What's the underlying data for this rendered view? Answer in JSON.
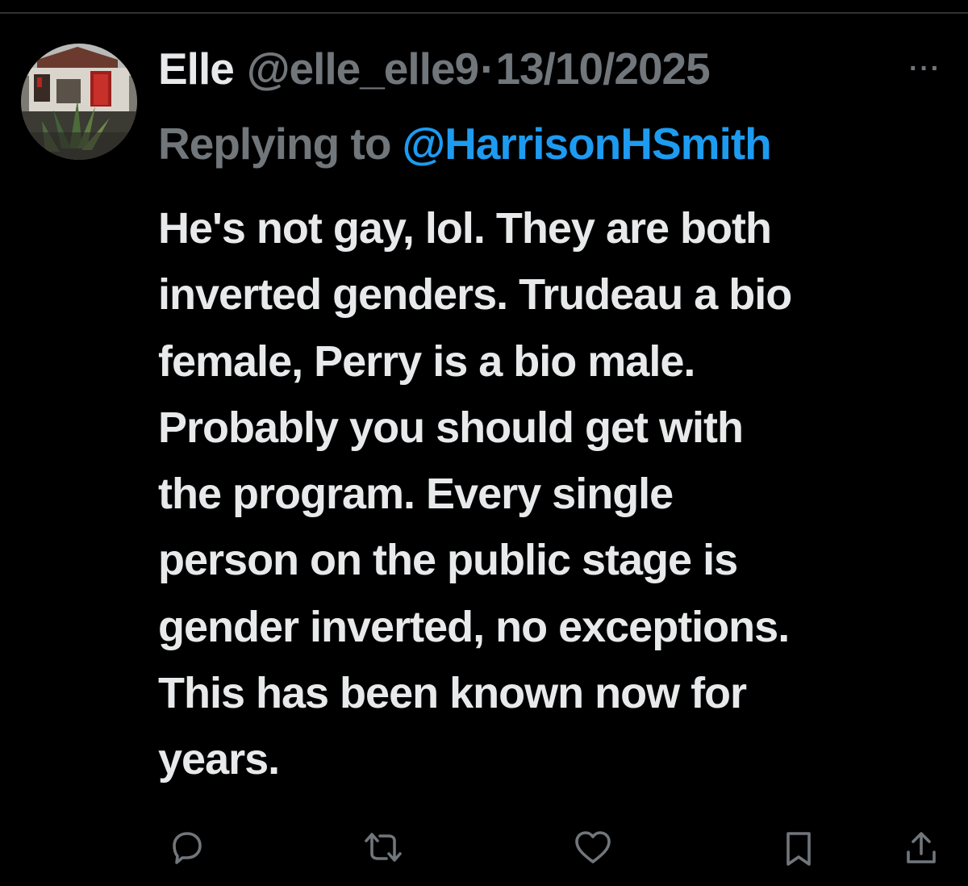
{
  "tweet": {
    "display_name": "Elle",
    "handle": "@elle_elle9",
    "separator": "·",
    "date": "13/10/2025",
    "more_label": "···",
    "replying_label": "Replying to",
    "replying_to": "@HarrisonHSmith",
    "body_lines": [
      "He's not gay, lol. They are both",
      "inverted genders. Trudeau a bio",
      "female, Perry is a bio male.",
      "Probably you should get with",
      "the program. Every single",
      "person on the public stage is",
      "gender inverted, no exceptions.",
      "This has been known now for",
      "years."
    ]
  },
  "actions": [
    {
      "name": "reply",
      "icon": "speech-bubble-icon"
    },
    {
      "name": "repost",
      "icon": "repost-arrows-icon"
    },
    {
      "name": "like",
      "icon": "heart-icon"
    },
    {
      "name": "bookmark",
      "icon": "bookmark-icon"
    },
    {
      "name": "share",
      "icon": "share-upload-icon"
    }
  ],
  "colors": {
    "background": "#000000",
    "primary_text": "#e7e9ea",
    "secondary_text": "#71767b",
    "link": "#1d9bf0",
    "divider": "#2f3336"
  }
}
